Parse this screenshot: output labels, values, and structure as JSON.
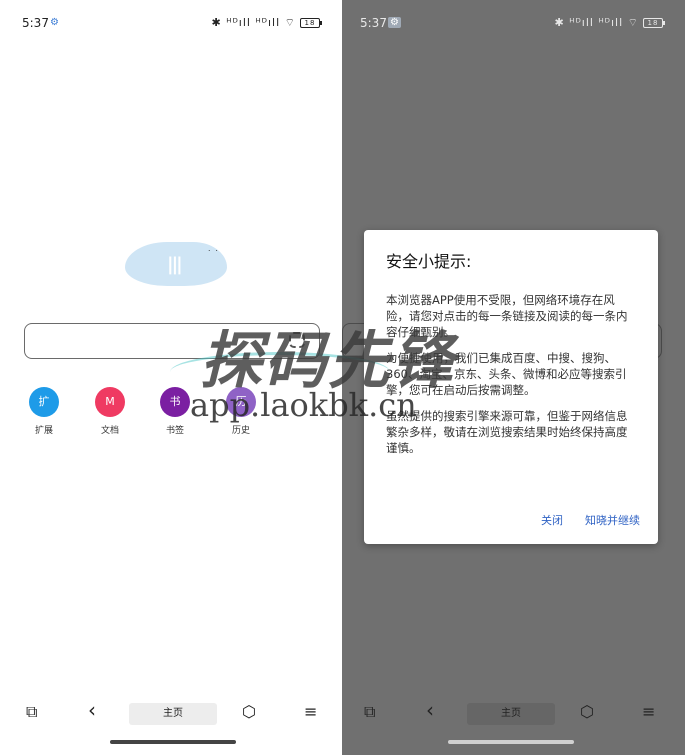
{
  "status_bar": {
    "time": "5:37",
    "sync_glyph": "⚙",
    "signal_text": "✱ ᴴᴰıll ᴴᴰıll ⌔",
    "battery": "18"
  },
  "browser": {
    "logo_mark": "|||",
    "logo_dots": "˙ ˙",
    "shortcuts": [
      {
        "glyph": "扩",
        "label": "扩展",
        "color": "#1e9be8"
      },
      {
        "glyph": "M",
        "label": "文档",
        "color": "#ef3a62"
      },
      {
        "glyph": "书",
        "label": "书签",
        "color": "#7b1fa2"
      },
      {
        "glyph": "历",
        "label": "历史",
        "color": "#8f62c6"
      }
    ]
  },
  "navbar": {
    "tabs_icon": "⧉",
    "back_icon": "‹",
    "home_label": "主页",
    "home_icon": "⬡",
    "menu_icon": "≡"
  },
  "dialog": {
    "title": "安全小提示:",
    "paragraph1": "本浏览器APP使用不受限，但网络环境存在风险，请您对点击的每一条链接及阅读的每一条内容仔细甄别。",
    "paragraph2": "为便捷使用，我们已集成百度、中搜、搜狗、360、淘宝、京东、头条、微博和必应等搜索引擎，您可在启动后按需调整。",
    "paragraph3": "虽然提供的搜索引擎来源可靠，但鉴于网络信息繁杂多样，敬请在浏览搜索结果时始终保持高度谨慎。",
    "close_label": "关闭",
    "continue_label": "知晓并继续"
  },
  "watermark": {
    "main_text": "探码先锋",
    "url_text": "app.laokbk.cn"
  },
  "colors": {
    "accent_link": "#2f62c4",
    "dim_overlay": "#707070",
    "logo_blue": "#cfe5f5"
  }
}
